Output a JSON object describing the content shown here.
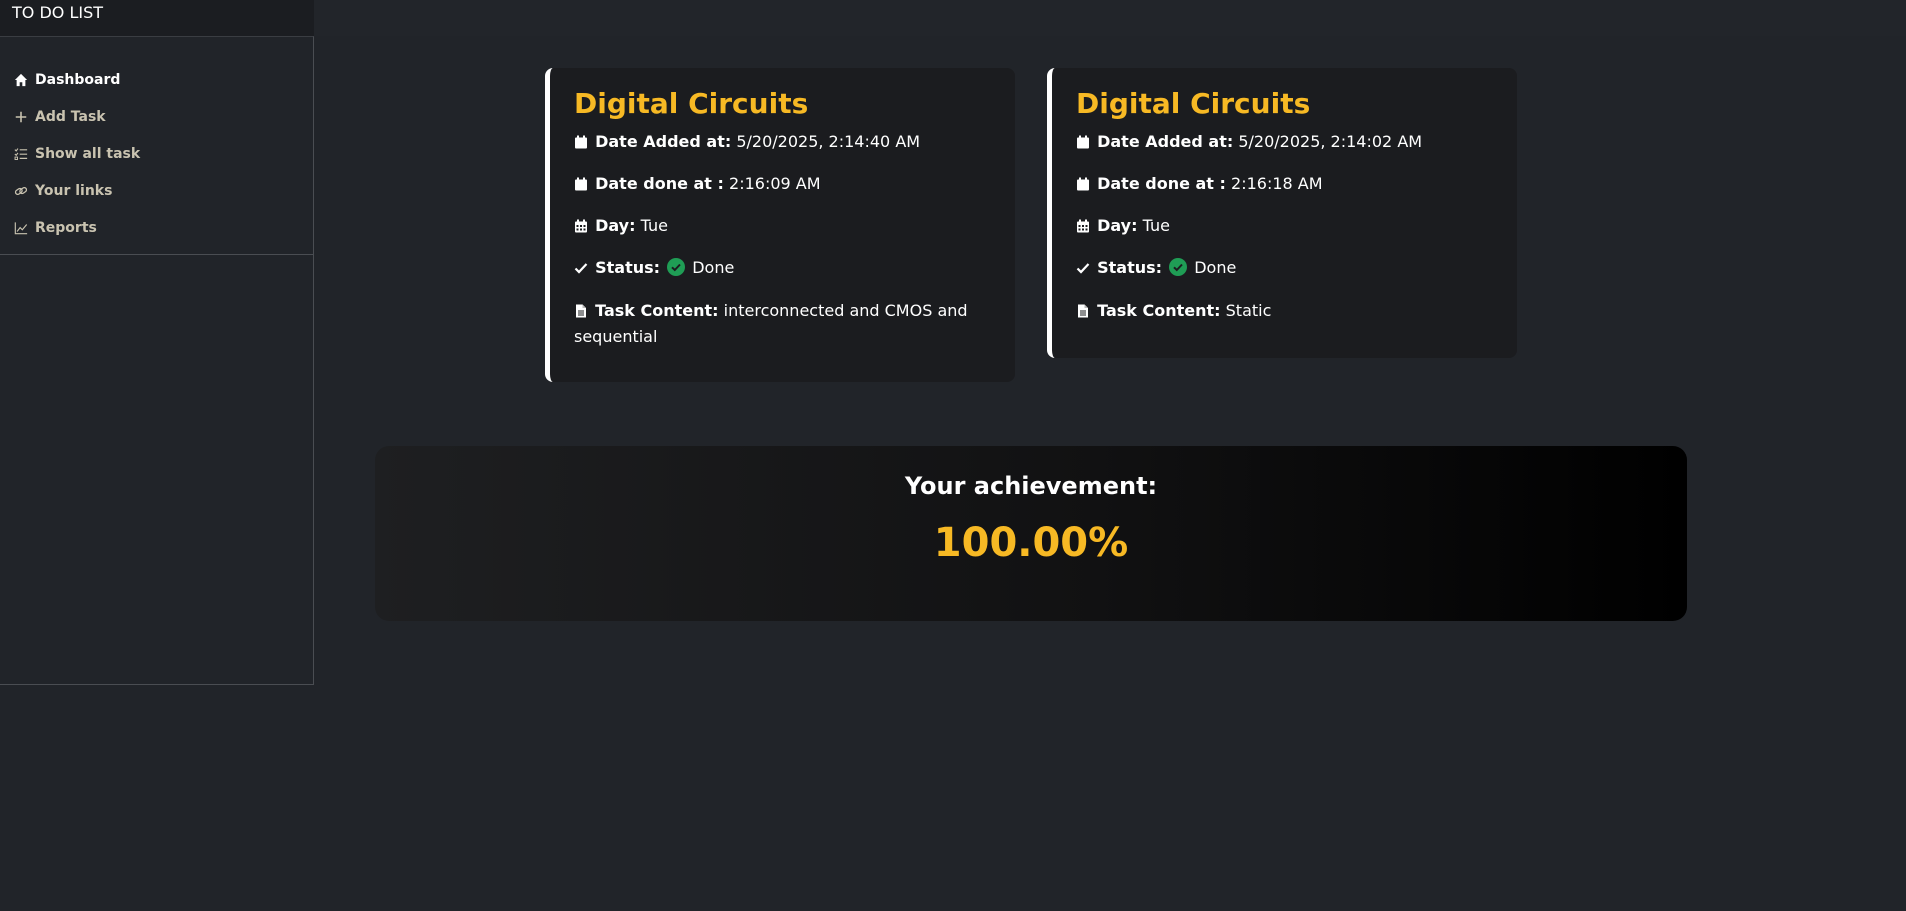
{
  "app": {
    "brand": "TO DO LIST"
  },
  "sidebar": {
    "items": [
      {
        "label": "Dashboard",
        "icon": "home-icon",
        "active": true
      },
      {
        "label": "Add Task",
        "icon": "plus-icon",
        "active": false
      },
      {
        "label": "Show all task",
        "icon": "list-check-icon",
        "active": false
      },
      {
        "label": "Your links",
        "icon": "link-icon",
        "active": false
      },
      {
        "label": "Reports",
        "icon": "chart-line-icon",
        "active": false
      }
    ]
  },
  "labels": {
    "date_added": "Date Added at:",
    "date_done": "Date done at :",
    "day": "Day:",
    "status": "Status:",
    "task_content": "Task Content:"
  },
  "tasks": [
    {
      "title": "Digital Circuits",
      "date_added": "5/20/2025, 2:14:40 AM",
      "date_done": "2:16:09 AM",
      "day": "Tue",
      "status": "Done",
      "content": "interconnected and CMOS and sequential"
    },
    {
      "title": "Digital Circuits",
      "date_added": "5/20/2025, 2:14:02 AM",
      "date_done": "2:16:18 AM",
      "day": "Tue",
      "status": "Done",
      "content": "Static"
    }
  ],
  "achievement": {
    "label": "Your achievement:",
    "value": "100.00%"
  },
  "colors": {
    "accent": "#f7b924",
    "done": "#1f9d55",
    "background": "#212429"
  }
}
